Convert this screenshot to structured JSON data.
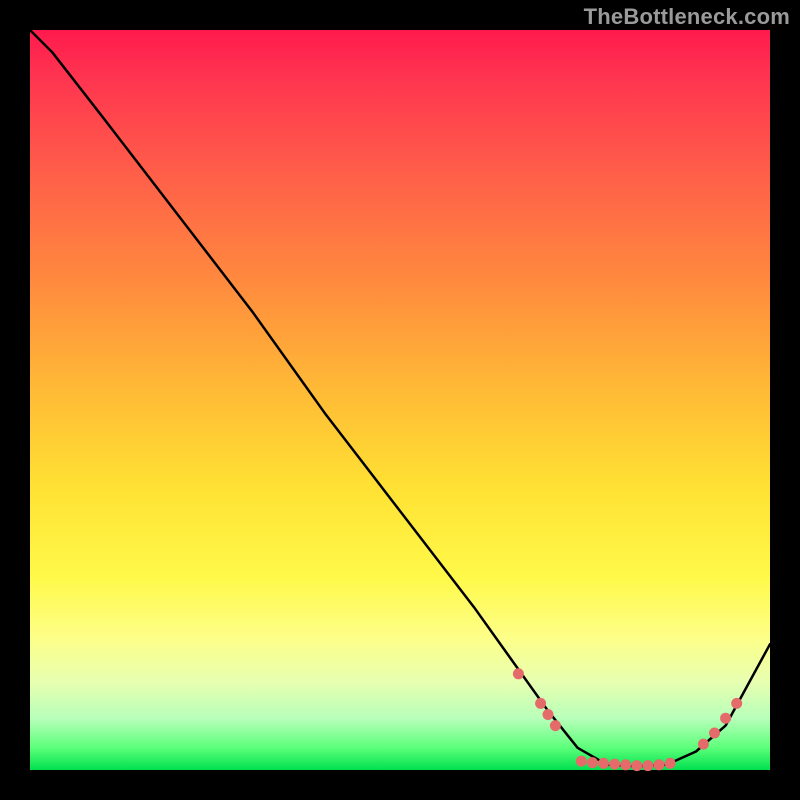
{
  "watermark": "TheBottleneck.com",
  "chart_data": {
    "type": "line",
    "title": "",
    "xlabel": "",
    "ylabel": "",
    "xlim": [
      0,
      100
    ],
    "ylim": [
      0,
      100
    ],
    "grid": false,
    "legend": false,
    "background_gradient": {
      "direction": "vertical",
      "stops": [
        {
          "pos": 0,
          "color": "#ff1a4d"
        },
        {
          "pos": 18,
          "color": "#ff5a4a"
        },
        {
          "pos": 48,
          "color": "#ffb836"
        },
        {
          "pos": 74,
          "color": "#fff94a"
        },
        {
          "pos": 93,
          "color": "#b8ffba"
        },
        {
          "pos": 100,
          "color": "#00e04e"
        }
      ]
    },
    "series": [
      {
        "name": "bottleneck-curve",
        "x": [
          0,
          3,
          10,
          20,
          30,
          40,
          50,
          60,
          65,
          70,
          74,
          78,
          82,
          86,
          90,
          94,
          100
        ],
        "y": [
          100,
          97,
          88,
          75,
          62,
          48,
          35,
          22,
          15,
          8,
          3,
          0.7,
          0.5,
          0.7,
          2.5,
          6,
          17
        ]
      }
    ],
    "markers": [
      {
        "x": 66,
        "y": 13
      },
      {
        "x": 69,
        "y": 9
      },
      {
        "x": 70,
        "y": 7.5
      },
      {
        "x": 71,
        "y": 6
      },
      {
        "x": 74.5,
        "y": 1.2
      },
      {
        "x": 76,
        "y": 1.0
      },
      {
        "x": 77.5,
        "y": 0.9
      },
      {
        "x": 79,
        "y": 0.8
      },
      {
        "x": 80.5,
        "y": 0.7
      },
      {
        "x": 82,
        "y": 0.6
      },
      {
        "x": 83.5,
        "y": 0.6
      },
      {
        "x": 85,
        "y": 0.7
      },
      {
        "x": 86.5,
        "y": 0.9
      },
      {
        "x": 91,
        "y": 3.5
      },
      {
        "x": 92.5,
        "y": 5
      },
      {
        "x": 94,
        "y": 7
      },
      {
        "x": 95.5,
        "y": 9
      }
    ]
  }
}
